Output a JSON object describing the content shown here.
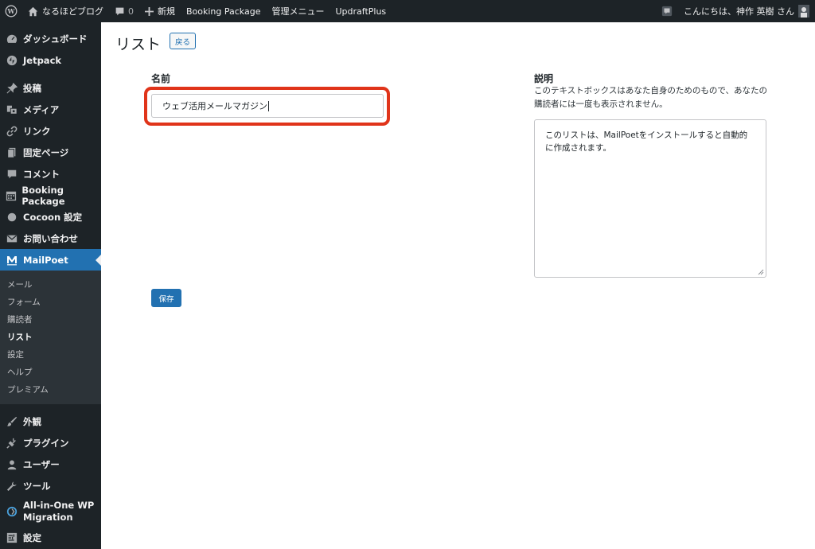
{
  "adminbar": {
    "site_name": "なるほどブログ",
    "comments_count": "0",
    "new_label": "新規",
    "booking_label": "Booking Package",
    "admin_menu_label": "管理メニュー",
    "updraft_label": "UpdraftPlus",
    "greeting": "こんにちは、神作 英樹 さん"
  },
  "sidebar": {
    "items_top": [
      {
        "label": "ダッシュボード",
        "icon": "dashboard-icon"
      },
      {
        "label": "Jetpack",
        "icon": "jetpack-icon"
      }
    ],
    "items_mid": [
      {
        "label": "投稿",
        "icon": "pin-icon"
      },
      {
        "label": "メディア",
        "icon": "media-icon"
      },
      {
        "label": "リンク",
        "icon": "link-icon"
      },
      {
        "label": "固定ページ",
        "icon": "page-icon"
      },
      {
        "label": "コメント",
        "icon": "comment-icon"
      },
      {
        "label": "Booking Package",
        "icon": "calendar-icon"
      },
      {
        "label": "Cocoon 設定",
        "icon": "circle-icon"
      },
      {
        "label": "お問い合わせ",
        "icon": "mail-icon"
      }
    ],
    "active": {
      "label": "MailPoet",
      "icon": "mailpoet-icon"
    },
    "submenu": [
      "メール",
      "フォーム",
      "購読者",
      "リスト",
      "設定",
      "ヘルプ",
      "プレミアム"
    ],
    "submenu_current": 3,
    "items_bottom": [
      {
        "label": "外観",
        "icon": "brush-icon"
      },
      {
        "label": "プラグイン",
        "icon": "plugin-icon"
      },
      {
        "label": "ユーザー",
        "icon": "user-icon"
      },
      {
        "label": "ツール",
        "icon": "wrench-icon"
      },
      {
        "label": "All-in-One WP Migration",
        "icon": "migration-icon"
      },
      {
        "label": "設定",
        "icon": "settings-icon"
      }
    ]
  },
  "main": {
    "title": "リスト",
    "back_label": "戻る",
    "name_label": "名前",
    "name_value": "ウェブ活用メールマガジン",
    "desc_label": "説明",
    "desc_help": "このテキストボックスはあなた自身のためのもので、あなたの購読者には一度も表示されません。",
    "desc_value": "このリストは、MailPoetをインストールすると自動的に作成されます。",
    "save_label": "保存"
  },
  "colors": {
    "accent": "#2271b1",
    "highlight": "#e0341a",
    "sidebar_bg": "#1d2327"
  }
}
